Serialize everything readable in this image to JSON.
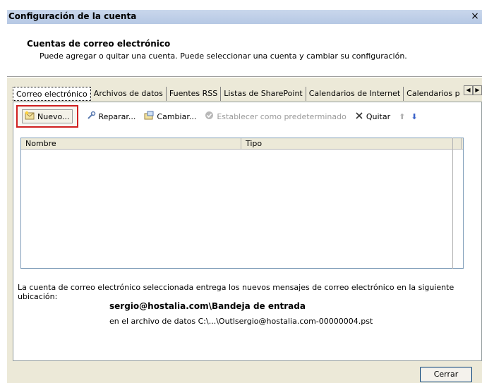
{
  "window": {
    "title": "Configuración de la cuenta",
    "close_glyph": "×"
  },
  "header": {
    "title": "Cuentas de correo electrónico",
    "subtitle": "Puede agregar o quitar una cuenta. Puede seleccionar una cuenta y cambiar su configuración."
  },
  "tabs": [
    {
      "label": "Correo electrónico",
      "active": true
    },
    {
      "label": "Archivos de datos",
      "active": false
    },
    {
      "label": "Fuentes RSS",
      "active": false
    },
    {
      "label": "Listas de SharePoint",
      "active": false
    },
    {
      "label": "Calendarios de Internet",
      "active": false
    },
    {
      "label": "Calendarios p",
      "active": false
    }
  ],
  "toolbar": {
    "new_label": "Nuevo...",
    "repair_label": "Reparar...",
    "change_label": "Cambiar...",
    "set_default_label": "Establecer como predeterminado",
    "remove_label": "Quitar"
  },
  "icons": {
    "new": "new-account-icon",
    "repair": "repair-icon",
    "change": "change-icon",
    "set_default": "check-circle-icon",
    "remove": "x-icon",
    "up": "arrow-up-icon",
    "down": "arrow-down-icon"
  },
  "list": {
    "columns": [
      "Nombre",
      "Tipo"
    ],
    "rows": []
  },
  "delivery": {
    "description": "La cuenta de correo electrónico seleccionada entrega los nuevos mensajes de correo electrónico en la siguiente ubicación:",
    "location": "sergio@hostalia.com\\Bandeja de entrada",
    "file": "en el archivo de datos C:\\...\\Outlsergio@hostalia.com-00000004.pst"
  },
  "footer": {
    "close_label": "Cerrar"
  },
  "colors": {
    "highlight": "#d02020",
    "titlebar": "#c9d7ec",
    "dialog_bg": "#ece9d8"
  }
}
